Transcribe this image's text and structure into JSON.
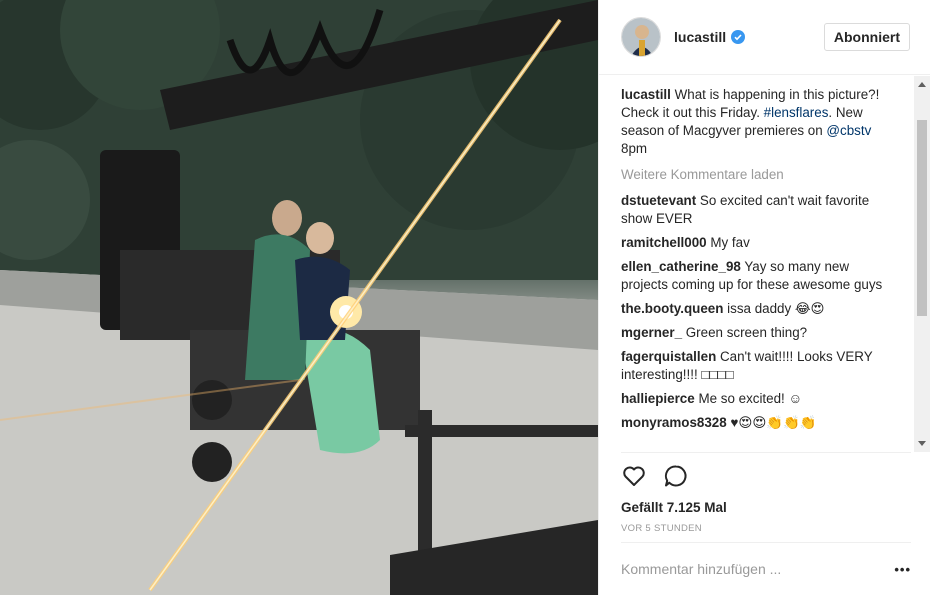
{
  "post": {
    "username": "lucastill",
    "follow_label": "Abonniert",
    "caption": {
      "user": "lucastill",
      "text1": "What is happening in this picture?! Check it out this Friday. ",
      "hashtag": "#lensflares",
      "text2": ". New season of Macgyver premieres on ",
      "mention": "@cbstv",
      "text3": " 8pm"
    },
    "load_more": "Weitere Kommentare laden",
    "comments": [
      {
        "user": "dstuetevant",
        "text": "So excited can't wait favorite show EVER"
      },
      {
        "user": "ramitchell000",
        "text": "My fav"
      },
      {
        "user": "ellen_catherine_98",
        "text": "Yay so many new projects coming up for these awesome guys"
      },
      {
        "user": "the.booty.queen",
        "text": "issa daddy 😂😍"
      },
      {
        "user": "mgerner_",
        "text": "Green screen thing?"
      },
      {
        "user": "fagerquistallen",
        "text": "Can't wait!!!! Looks VERY interesting!!!! □□□□"
      },
      {
        "user": "halliepierce",
        "text": "Me so excited! ☺"
      },
      {
        "user": "monyramos8328",
        "text": "♥😍😍👏👏👏"
      }
    ],
    "likes": "Gefällt 7.125 Mal",
    "timestamp": "VOR 5 STUNDEN",
    "comment_placeholder": "Kommentar hinzufügen ...",
    "more_options": "•••",
    "icons": {
      "like": "heart-icon",
      "comment": "comment-bubble-icon",
      "verified": "verified-badge-icon"
    },
    "colors": {
      "link": "#003569",
      "verified": "#3897f0",
      "muted": "#999999"
    }
  }
}
